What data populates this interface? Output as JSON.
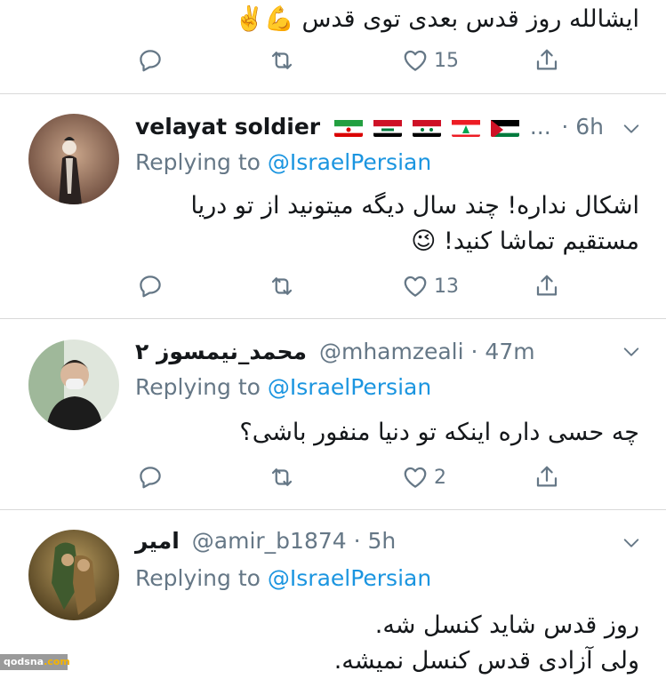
{
  "tweets": [
    {
      "body": "ایشالله روز قدس بعدی توی قدس 💪✌️",
      "stats": {
        "replies": "",
        "retweets": "",
        "likes": "15"
      }
    },
    {
      "author": "velayat soldier",
      "flags_suffix": "...",
      "time": "· 6h",
      "replying_prefix": "Replying to ",
      "replying_handle": "@IsraelPersian",
      "body": "اشکال نداره! چند سال دیگه میتونید از تو دریا مستقیم تماشا کنید! 😉",
      "stats": {
        "likes": "13"
      }
    },
    {
      "author": "محمد_نیمسوز ۲",
      "handle": "@mhamzeali",
      "time": "· 47m",
      "replying_prefix": "Replying to ",
      "replying_handle": "@IsraelPersian",
      "body": "چه حسی داره اینکه تو دنیا منفور باشی؟",
      "stats": {
        "likes": "2"
      }
    },
    {
      "author": "امیر",
      "handle": "@amir_b1874",
      "time": "· 5h",
      "replying_prefix": "Replying to ",
      "replying_handle": "@IsraelPersian",
      "body_lines": [
        "روز قدس شاید کنسل شه.",
        "ولی آزادی قدس کنسل نمیشه."
      ]
    }
  ],
  "watermark": {
    "brand": "qodsna",
    "tld": ".com"
  },
  "icons": [
    "reply-icon",
    "retweet-icon",
    "like-icon",
    "share-icon",
    "chevron-down-icon"
  ],
  "colors": {
    "link": "#1b95e0",
    "muted": "#657786",
    "text": "#14171a",
    "divider": "#d9d9d9"
  }
}
